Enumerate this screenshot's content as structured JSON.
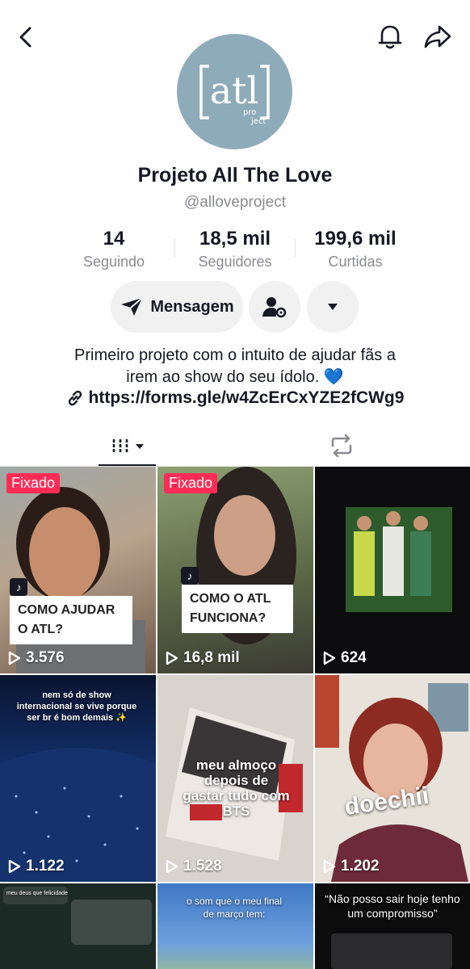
{
  "header": {
    "back_icon": "chevron-left-icon",
    "bell_icon": "bell-icon",
    "share_icon": "share-arrow-icon"
  },
  "profile": {
    "avatar_text": "atl",
    "avatar_subtext": "project",
    "name": "Projeto All The Love",
    "handle": "@alloveproject"
  },
  "stats": [
    {
      "value": "14",
      "label": "Seguindo"
    },
    {
      "value": "18,5 mil",
      "label": "Seguidores"
    },
    {
      "value": "199,6 mil",
      "label": "Curtidas"
    }
  ],
  "actions": {
    "message_label": "Mensagem"
  },
  "bio": {
    "line1": "Primeiro projeto com o intuito de ajudar fãs a",
    "line2": "irem ao show do seu ídolo. 💙",
    "link": "https://forms.gle/w4ZcErCxYZE2fCWg9"
  },
  "tabs": {
    "active": "videos-grid-icon",
    "second": "repost-icon"
  },
  "grid": [
    {
      "pinned": "Fixado",
      "caption": "COMO AJUDAR O ATL?",
      "views": "3.576"
    },
    {
      "pinned": "Fixado",
      "caption": "COMO O ATL FUNCIONA?",
      "views": "16,8 mil"
    },
    {
      "views": "624"
    },
    {
      "overlay": "nem só de show internacional se vive porque ser br é bom demais ✨",
      "views": "1.122"
    },
    {
      "overlay": "meu almoço depois de gastar tudo com BTS",
      "views": "1.528"
    },
    {
      "overlay": "doechii",
      "views": "1.202"
    },
    {
      "overlay": "meu deus que felicidade"
    },
    {
      "overlay": "o som que o meu final de março tem:"
    },
    {
      "overlay": "“Não posso sair hoje tenho um compromisso”"
    }
  ],
  "colors": {
    "accent": "#fe2c55",
    "text": "#161823",
    "muted": "#8a8b91",
    "button_bg": "#f1f1f2"
  }
}
